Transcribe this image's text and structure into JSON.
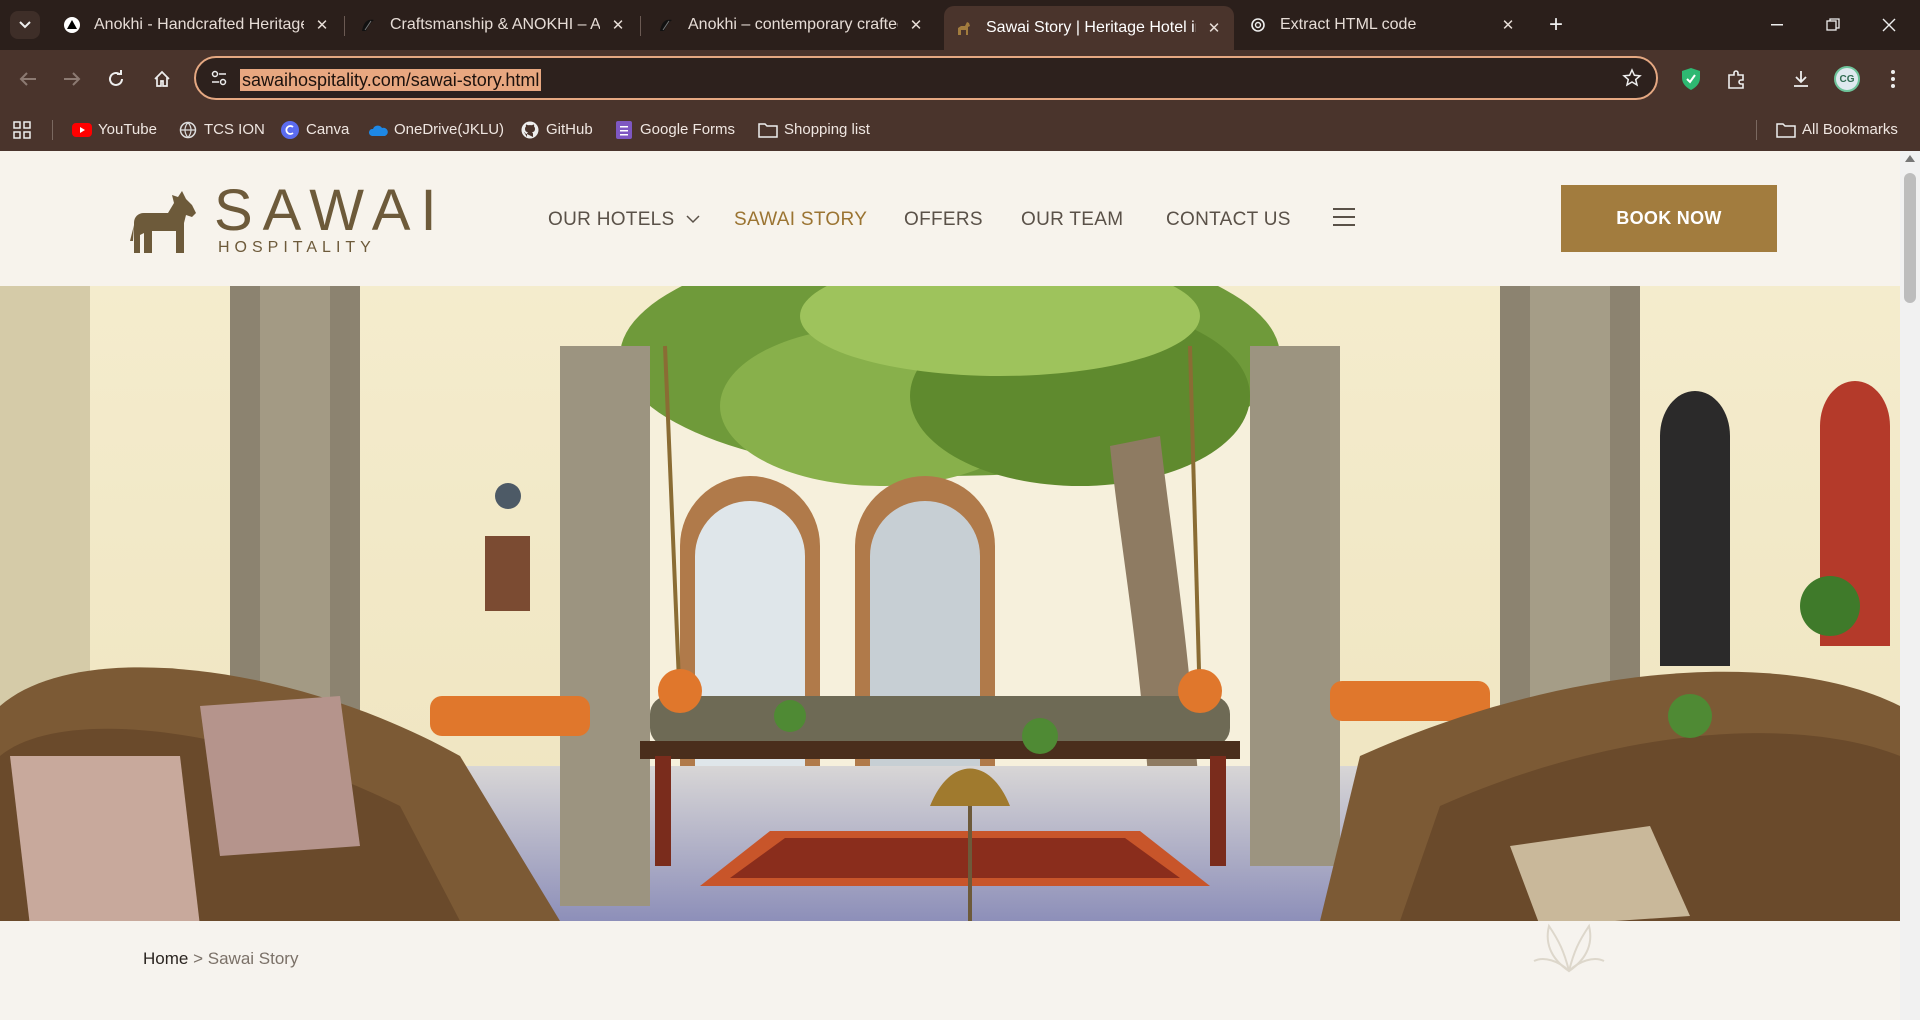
{
  "browser": {
    "tabs": [
      {
        "title": "Anokhi - Handcrafted Heritage,",
        "favicon": "triangle-logo-icon"
      },
      {
        "title": "Craftsmanship & ANOKHI – An",
        "favicon": "anokhi-logo-icon"
      },
      {
        "title": "Anokhi – contemporary crafted",
        "favicon": "anokhi-logo-icon"
      },
      {
        "title": "Sawai Story | Heritage Hotel in",
        "favicon": "horse-logo-icon"
      },
      {
        "title": "Extract HTML code",
        "favicon": "openai-logo-icon"
      }
    ],
    "active_tab_index": 3,
    "url": "sawaihospitality.com/sawai-story.html",
    "bookmarks": [
      {
        "label": "YouTube",
        "icon": "youtube-icon"
      },
      {
        "label": "TCS ION",
        "icon": "globe-icon"
      },
      {
        "label": "Canva",
        "icon": "canva-icon"
      },
      {
        "label": "OneDrive(JKLU)",
        "icon": "onedrive-icon"
      },
      {
        "label": "GitHub",
        "icon": "github-icon"
      },
      {
        "label": "Google Forms",
        "icon": "google-forms-icon"
      },
      {
        "label": "Shopping list",
        "icon": "folder-icon"
      }
    ],
    "all_bookmarks": "All Bookmarks",
    "avatar_initials": "CG"
  },
  "site": {
    "logo": {
      "name": "SAWAI",
      "tagline": "HOSPITALITY"
    },
    "nav": [
      {
        "label": "OUR HOTELS",
        "dropdown": true
      },
      {
        "label": "SAWAI STORY",
        "active": true
      },
      {
        "label": "OFFERS"
      },
      {
        "label": "OUR TEAM"
      },
      {
        "label": "CONTACT US"
      }
    ],
    "book_now": "BOOK NOW",
    "breadcrumb": {
      "home": "Home",
      "separator": ">",
      "current": "Sawai Story"
    },
    "colors": {
      "gold": "#a27c3e",
      "browser_dark": "#2b1f1b",
      "browser_mid": "#4a342c"
    }
  }
}
